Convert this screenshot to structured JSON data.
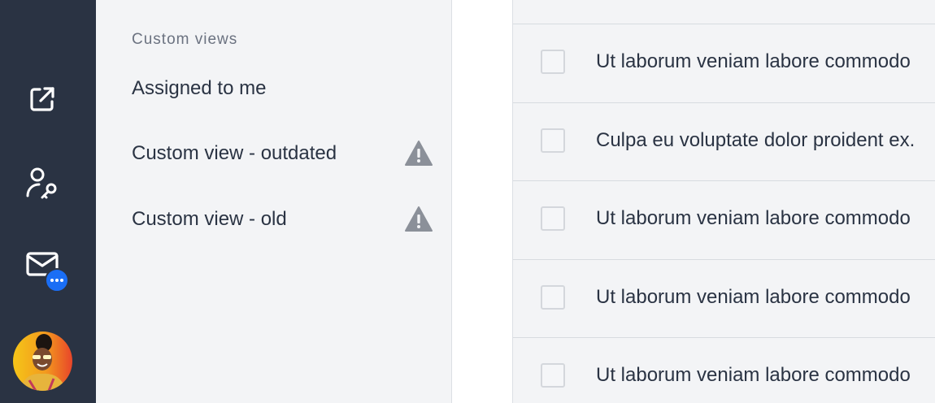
{
  "sidebar": {
    "icons": [
      "external-link-icon",
      "user-key-icon",
      "mail-icon"
    ],
    "notification_badge": "...",
    "accent_color": "#1a6ef5"
  },
  "views": {
    "section_title": "Custom views",
    "items": [
      {
        "label": "Assigned to me",
        "warning": false
      },
      {
        "label": "Custom view - outdated",
        "warning": true
      },
      {
        "label": "Custom view - old",
        "warning": true
      }
    ]
  },
  "list": {
    "rows": [
      {
        "text": "Ut laborum veniam labore commodo"
      },
      {
        "text": "Culpa eu voluptate dolor proident ex."
      },
      {
        "text": "Ut laborum veniam labore commodo"
      },
      {
        "text": "Ut laborum veniam labore commodo"
      },
      {
        "text": "Ut laborum veniam labore commodo"
      }
    ]
  }
}
